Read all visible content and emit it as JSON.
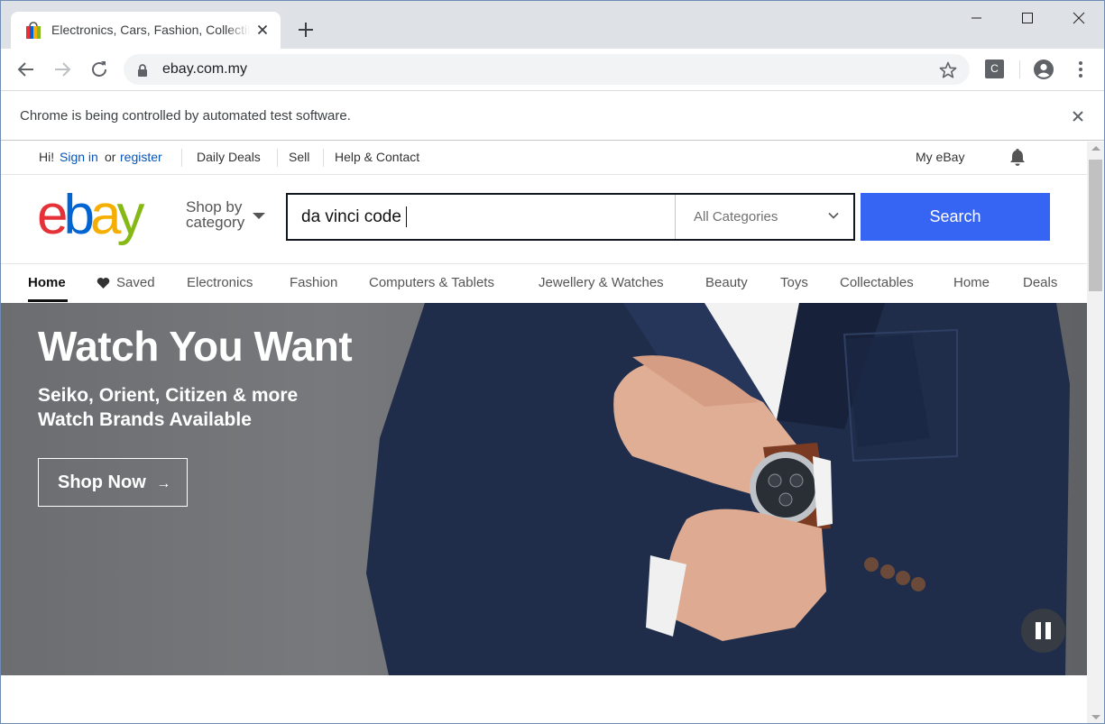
{
  "browser": {
    "tab_title": "Electronics, Cars, Fashion, Collectibles & More | eBay",
    "url": "ebay.com.my",
    "infobar_text": "Chrome is being controlled by automated test software.",
    "extension_label": "C",
    "icons": [
      "ebay-favicon",
      "close-icon",
      "plus-icon",
      "minimize-icon",
      "maximize-icon",
      "window-close-icon",
      "back-arrow-icon",
      "forward-arrow-icon",
      "reload-icon",
      "lock-icon",
      "star-icon",
      "profile-icon",
      "kebab-menu-icon"
    ]
  },
  "ebay": {
    "topbar": {
      "greeting": "Hi!",
      "sign_in": "Sign in",
      "or": "or",
      "register": "register",
      "daily_deals": "Daily Deals",
      "sell": "Sell",
      "help": "Help & Contact",
      "my_ebay": "My eBay"
    },
    "header": {
      "shop_by_line1": "Shop by",
      "shop_by_line2": "category",
      "search_value": "da vinci code",
      "category_selected": "All Categories",
      "search_button": "Search"
    },
    "categories": [
      "Home",
      "Saved",
      "Electronics",
      "Fashion",
      "Computers & Tablets",
      "Jewellery & Watches",
      "Beauty",
      "Toys",
      "Collectables",
      "Home",
      "Deals"
    ],
    "hero": {
      "title": "Watch You Want",
      "subtitle_line1": "Seiko, Orient, Citizen & more",
      "subtitle_line2": "Watch Brands Available",
      "cta": "Shop Now",
      "cta_icon": "→"
    },
    "colors": {
      "search_button": "#3665f3",
      "link": "#0654ba",
      "logo": [
        "#e53238",
        "#0064d2",
        "#f5af02",
        "#86b817"
      ]
    }
  }
}
